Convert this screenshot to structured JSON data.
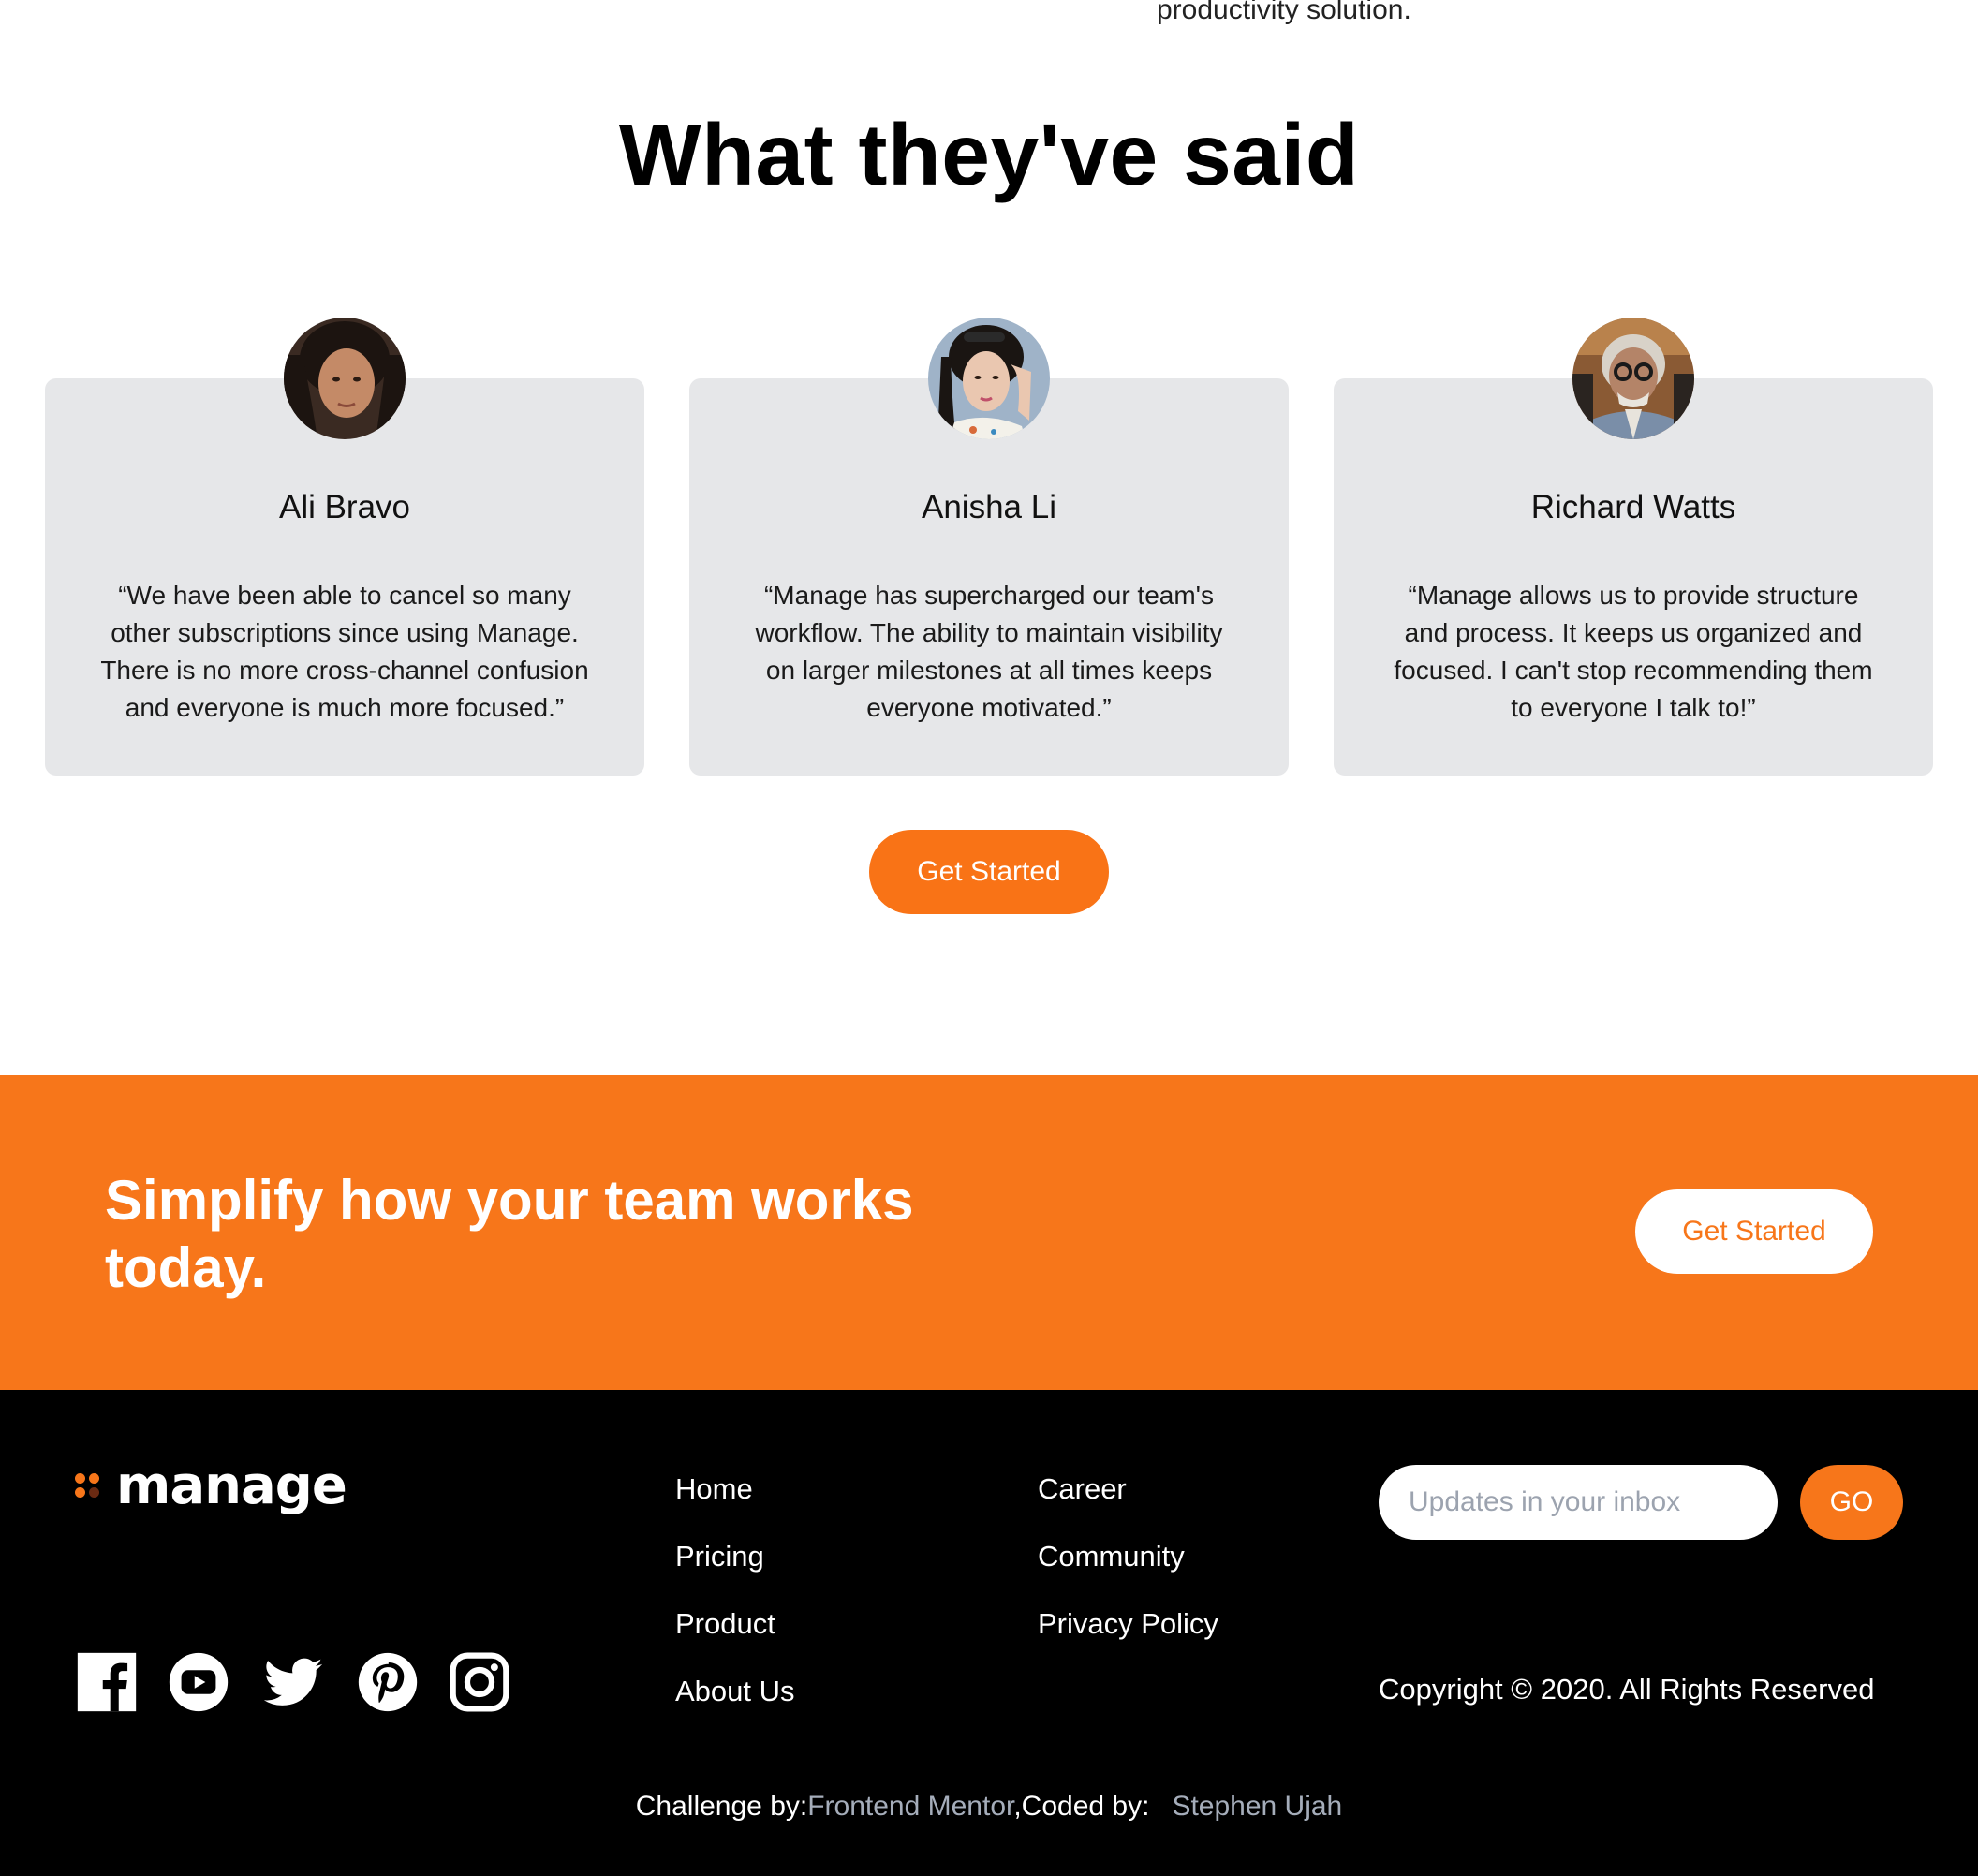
{
  "top_fragment": "productivity solution.",
  "testimonials": {
    "title": "What they've said",
    "items": [
      {
        "name": "Ali Bravo",
        "quote": "“We have been able to cancel so many other subscriptions since using Manage. There is no more cross-channel confusion and everyone is much more focused.”"
      },
      {
        "name": "Anisha Li",
        "quote": "“Manage has supercharged our team's workflow. The ability to maintain visibility on larger milestones at all times keeps everyone motivated.”"
      },
      {
        "name": "Richard Watts",
        "quote": "“Manage allows us to provide structure and process. It keeps us organized and focused. I can't stop recommending them to everyone I talk to!”"
      }
    ],
    "cta_label": "Get Started"
  },
  "cta_band": {
    "heading": "Simplify how your team works today.",
    "button_label": "Get Started"
  },
  "footer": {
    "logo_text": "manage",
    "nav_col1": [
      "Home",
      "Pricing",
      "Product",
      "About Us"
    ],
    "nav_col2": [
      "Career",
      "Community",
      "Privacy Policy"
    ],
    "newsletter": {
      "placeholder": "Updates in your inbox",
      "button_label": "GO"
    },
    "copyright": "Copyright © 2020. All Rights Reserved",
    "attribution": {
      "challenge_label": "Challenge by:",
      "challenge_link": "Frontend Mentor",
      "coded_label": ",Coded by:",
      "coder_link": "Stephen Ujah"
    },
    "social_icons": [
      "facebook-icon",
      "youtube-icon",
      "twitter-icon",
      "pinterest-icon",
      "instagram-icon"
    ]
  },
  "colors": {
    "accent": "#f7761a",
    "card_bg": "#e6e7e9",
    "footer_bg": "#000000",
    "link_muted": "#a5adba"
  }
}
